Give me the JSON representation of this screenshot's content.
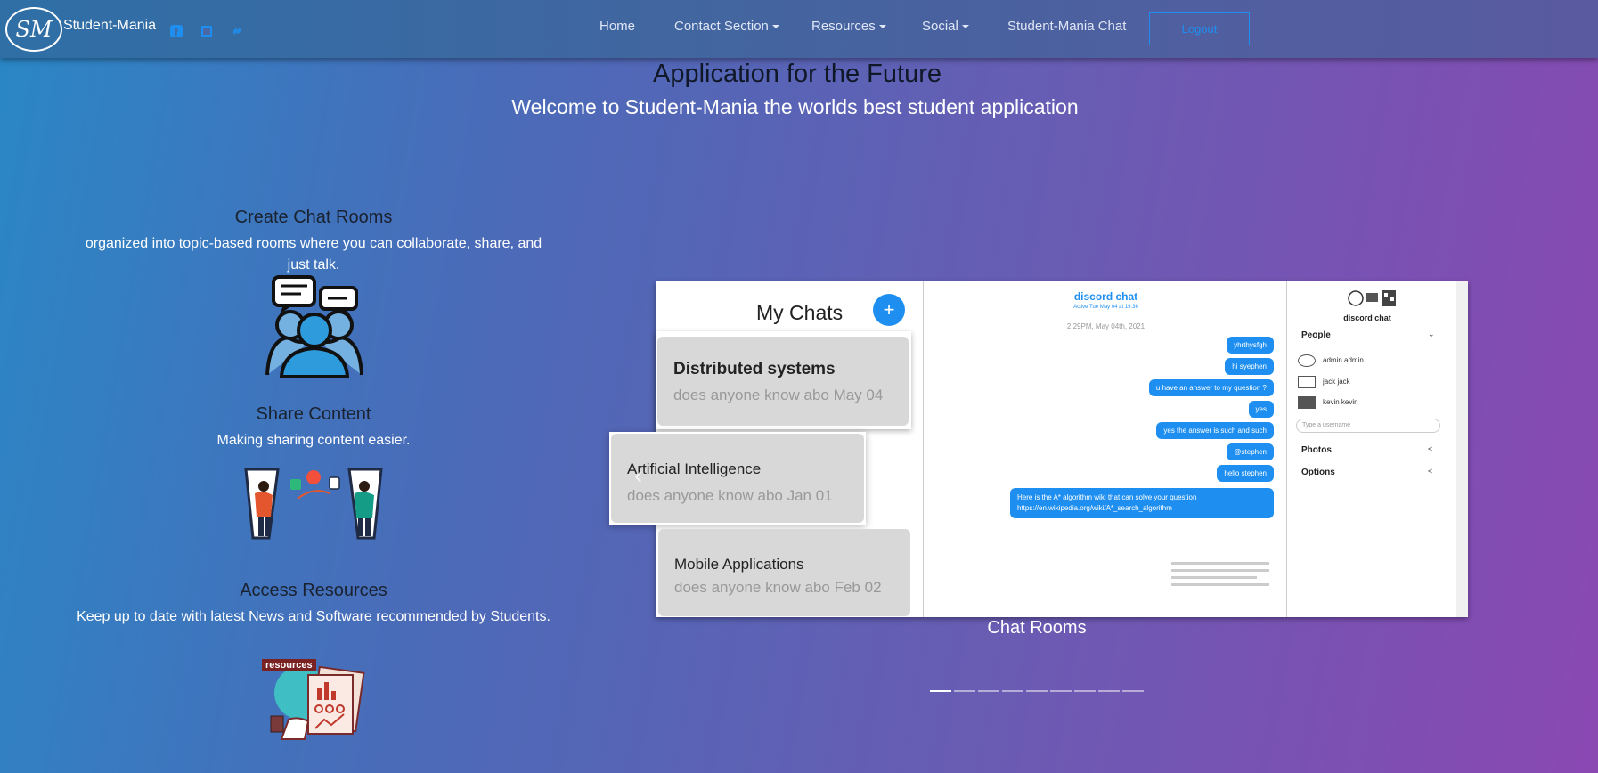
{
  "brand": {
    "logo_text": "SM",
    "name": "Student-Mania"
  },
  "social_icons": [
    "facebook-icon",
    "square-icon",
    "link-icon"
  ],
  "nav": {
    "items": [
      {
        "label": "Home",
        "dropdown": false
      },
      {
        "label": "Contact Section",
        "dropdown": true
      },
      {
        "label": "Resources",
        "dropdown": true
      },
      {
        "label": "Social",
        "dropdown": true
      },
      {
        "label": "Student-Mania Chat",
        "dropdown": false
      }
    ],
    "logout": "Logout"
  },
  "hero": {
    "title": "Application for the Future",
    "subtitle": "Welcome to Student-Mania the worlds best student application"
  },
  "features": [
    {
      "title": "Create Chat Rooms",
      "desc": "organized into topic-based rooms where you can collaborate, share, and just talk.",
      "icon": "chat-people-icon"
    },
    {
      "title": "Share Content",
      "desc": "Making sharing content easier.",
      "icon": "share-content-icon"
    },
    {
      "title": "Access Resources",
      "desc": "Keep up to date with latest News and Software recommended by Students.",
      "icon": "resources-icon",
      "badge": "resources"
    }
  ],
  "carousel": {
    "caption": "Chat Rooms",
    "slide_count": 9,
    "active_index": 0,
    "screenshot": {
      "my_chats": "My Chats",
      "plus": "+",
      "chats": [
        {
          "title": "Distributed systems",
          "snippet": "does anyone know abo",
          "date": "May 04"
        },
        {
          "title": "Artificial Intelligence",
          "snippet": "does anyone know abo",
          "date": "Jan 01"
        },
        {
          "title": "Mobile Applications",
          "snippet": "does anyone know abo",
          "date": "Feb 02"
        }
      ],
      "chat_name": "discord chat",
      "chat_active": "Active Tue May 04 at 19:36",
      "chat_date": "2:29PM, May 04th, 2021",
      "messages": [
        "yhrthysfgh",
        "hi syephen",
        "u have an answer to my question ?",
        "yes",
        "yes the answer is such and such",
        "@stephen",
        "hello stephen",
        "Here is the A* algorithm wiki that can solve your question",
        "https://en.wikipedia.org/wiki/A*_search_algorithm"
      ],
      "right_title": "discord chat",
      "people_label": "People",
      "people": [
        "admin admin",
        "jack jack",
        "kevin kevin"
      ],
      "username_placeholder": "Type a username",
      "photos_label": "Photos",
      "options_label": "Options"
    }
  }
}
